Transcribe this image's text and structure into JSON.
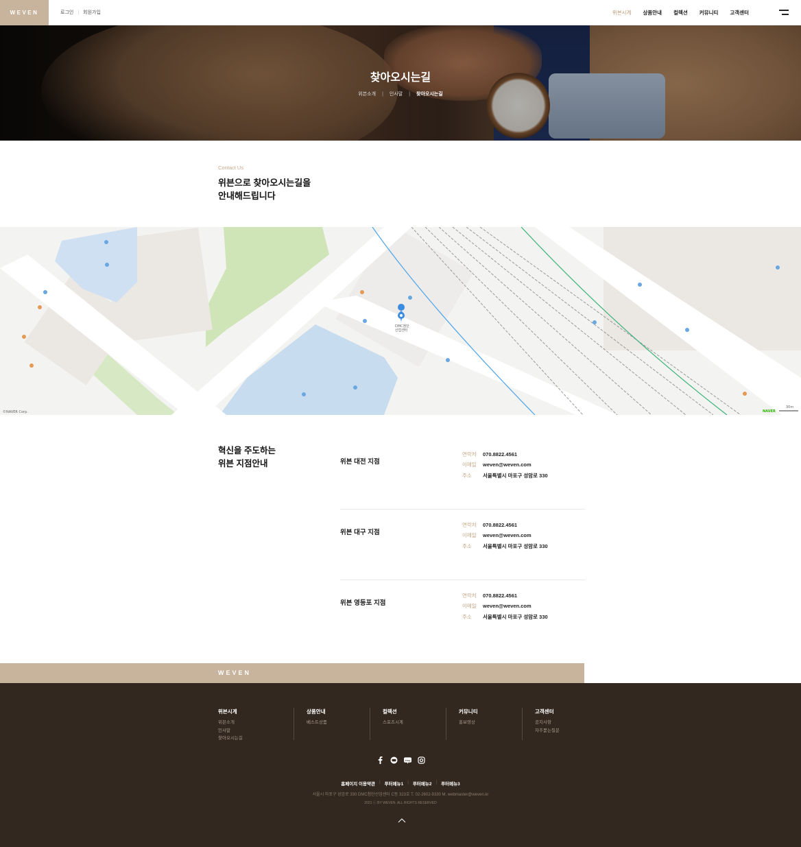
{
  "header": {
    "logo": "WEVEN",
    "login": "로그인",
    "join": "회원가입",
    "nav": [
      "위븐시계",
      "상품안내",
      "컬렉션",
      "커뮤니티",
      "고객센터"
    ],
    "active_index": 0
  },
  "hero": {
    "title": "찾아오시는길",
    "breadcrumb": [
      "위븐소개",
      "인사말",
      "찾아오시는길"
    ]
  },
  "intro": {
    "label": "Contact Us",
    "title_line1": "위븐으로 찾아오시는길을",
    "title_line2": "안내해드립니다"
  },
  "map": {
    "labels": {
      "dmc": "DMC첨단\n산업센터",
      "naver": "NAVER",
      "copyright": "©NAVER Corp.",
      "scale": "30m"
    }
  },
  "branches": {
    "title_line1": "혁신을 주도하는",
    "title_line2": "위븐 지점안내",
    "field_labels": {
      "phone": "연락처",
      "email": "이메일",
      "address": "주소"
    },
    "items": [
      {
        "name": "위븐 대전 지점",
        "phone": "070.8822.4561",
        "email": "weven@weven.com",
        "address": "서울특별시 마포구 성암로 330"
      },
      {
        "name": "위븐 대구 지점",
        "phone": "070.8822.4561",
        "email": "weven@weven.com",
        "address": "서울특별시 마포구 성암로 330"
      },
      {
        "name": "위븐 영등포 지점",
        "phone": "070.8822.4561",
        "email": "weven@weven.com",
        "address": "서울특별시 마포구 성암로 330"
      }
    ]
  },
  "footer": {
    "logo": "WEVEN",
    "columns": [
      {
        "title": "위븐시계",
        "items": [
          "위븐소개",
          "인사말",
          "찾아오시는길"
        ]
      },
      {
        "title": "상품안내",
        "items": [
          "베스트상품"
        ]
      },
      {
        "title": "컬렉션",
        "items": [
          "스포츠시계"
        ]
      },
      {
        "title": "커뮤니티",
        "items": [
          "홍보영상"
        ]
      },
      {
        "title": "고객센터",
        "items": [
          "공지사항",
          "자주묻는질문"
        ]
      }
    ],
    "links": [
      "홈페이지 이용약관",
      "푸터메뉴1",
      "푸터메뉴2",
      "푸터메뉴3"
    ],
    "address": "서울시 마포구 성암로 330 DMC첨단산업센터 C동 323호   T. 02-2602-9330   M. webmaster@weven.kr",
    "copyright": "2021 ⓒ BY WEVEN. ALL RIGHTS RESERVED"
  }
}
